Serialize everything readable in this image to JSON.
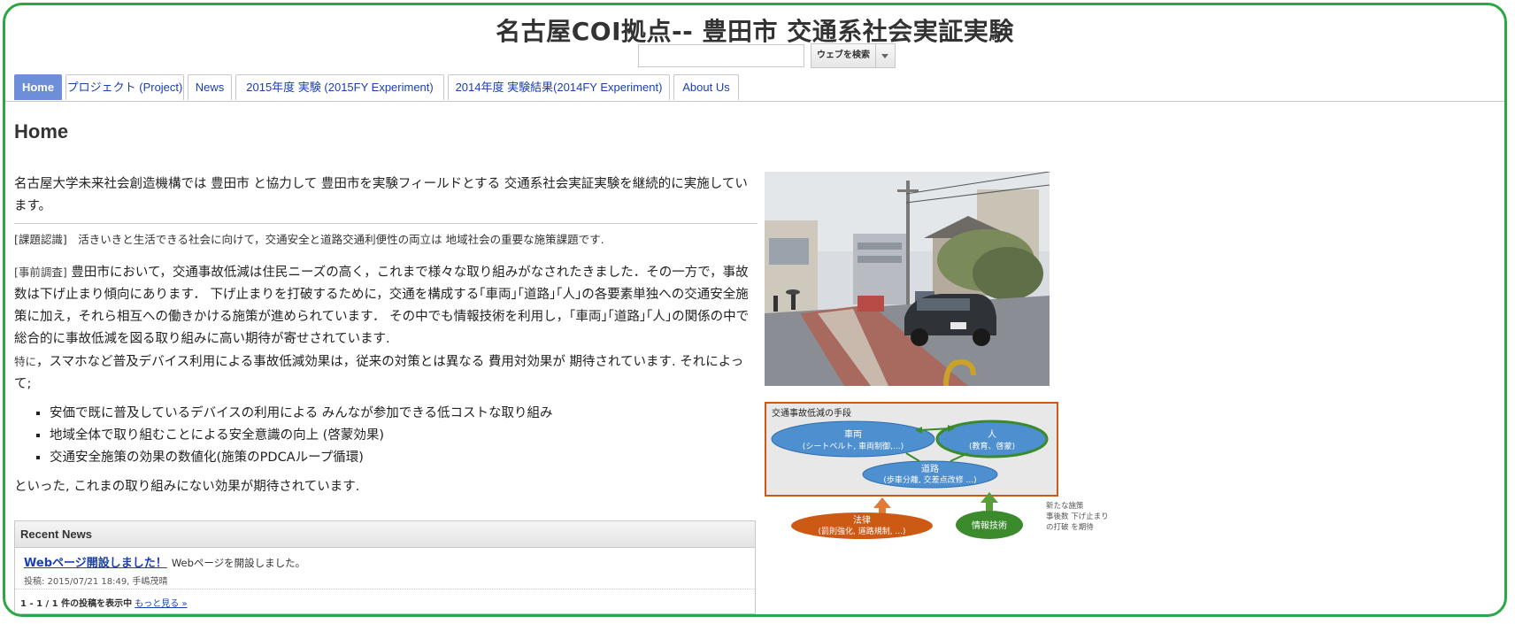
{
  "site_title": "名古屋COI拠点-- 豊田市 交通系社会実証実験",
  "search": {
    "placeholder": "",
    "button_label": "ウェブを検索"
  },
  "nav_tabs": [
    {
      "label": "Home"
    },
    {
      "label": "プロジェクト (Project)"
    },
    {
      "label": "News"
    },
    {
      "label": "2015年度 実験 (2015FY Experiment)"
    },
    {
      "label": "2014年度 実験結果(2014FY Experiment)"
    },
    {
      "label": "About Us"
    }
  ],
  "page_heading": "Home",
  "body": {
    "intro": "名古屋大学未来社会創造機構では 豊田市 と協力して 豊田市を実験フィールドとする 交通系社会実証実験を継続的に実施しています。",
    "issue": "[課題認識]　活きいきと生活できる社会に向けて，交通安全と道路交通利便性の両立は 地域社会の重要な施策課題です.",
    "prior_tag": "[事前調査]",
    "prior": " 豊田市において，交通事故低減は住民ニーズの高く，これまで様々な取り組みがなされたきました．その一方で，事故数は下げ止まり傾向にあります．  下げ止まりを打破するために，交通を構成する｢車両｣｢道路｣｢人｣の各要素単独への交通安全施策に加え，それら相互への働きかける施策が進められています．  その中でも情報技術を利用し，｢車両｣｢道路｣｢人｣の関係の中で 総合的に事故低減を図る取り組みに高い期待が寄せされています.",
    "especially_tag": "特に",
    "especially": "，スマホなど普及デバイス利用による事故低減効果は，従来の対策とは異なる 費用対効果が 期待されています. それによって;",
    "bullets": [
      "安価で既に普及しているデバイスの利用による みんなが参加できる低コストな取り組み",
      "地域全体で取り組むことによる安全意識の向上 (啓蒙効果)",
      "交通安全施策の効果の数値化(施策のPDCAループ循環)"
    ],
    "closing": "といった, これまの取り組みにない効果が期待されています."
  },
  "recent_news": {
    "title": "Recent News",
    "items": [
      {
        "link": "Webページ開設しました！",
        "text": "Webページを開設しました。",
        "meta": "投稿: 2015/07/21 18:49, 手嶋茂晴"
      }
    ],
    "footer": "1 - 1 / 1 件の投稿を表示中",
    "more": "もっと見る »"
  },
  "diagram": {
    "title": "交通事故低減の手段",
    "vehicle": "車両",
    "vehicle_sub": "(シートベルト, 車両制御,...)",
    "person": "人",
    "person_sub": "(教育、啓蒙)",
    "road": "道路",
    "road_sub": "(歩車分離, 交差点改修 ...)",
    "law": "法律",
    "law_sub": "(罰則強化, 道路規制, ...)",
    "it": "情報技術",
    "note_line1": "新たな施策",
    "note_line2": "事後数 下げ止まり",
    "note_line3": "の打破 を期待"
  },
  "colors": {
    "frame": "#2aa845",
    "tab_active": "#6d8fd9",
    "link": "#1a3fb0",
    "ellipse_blue": "#4e8fd0",
    "ellipse_orange": "#cc5a14",
    "ellipse_green": "#3b8a2c"
  }
}
